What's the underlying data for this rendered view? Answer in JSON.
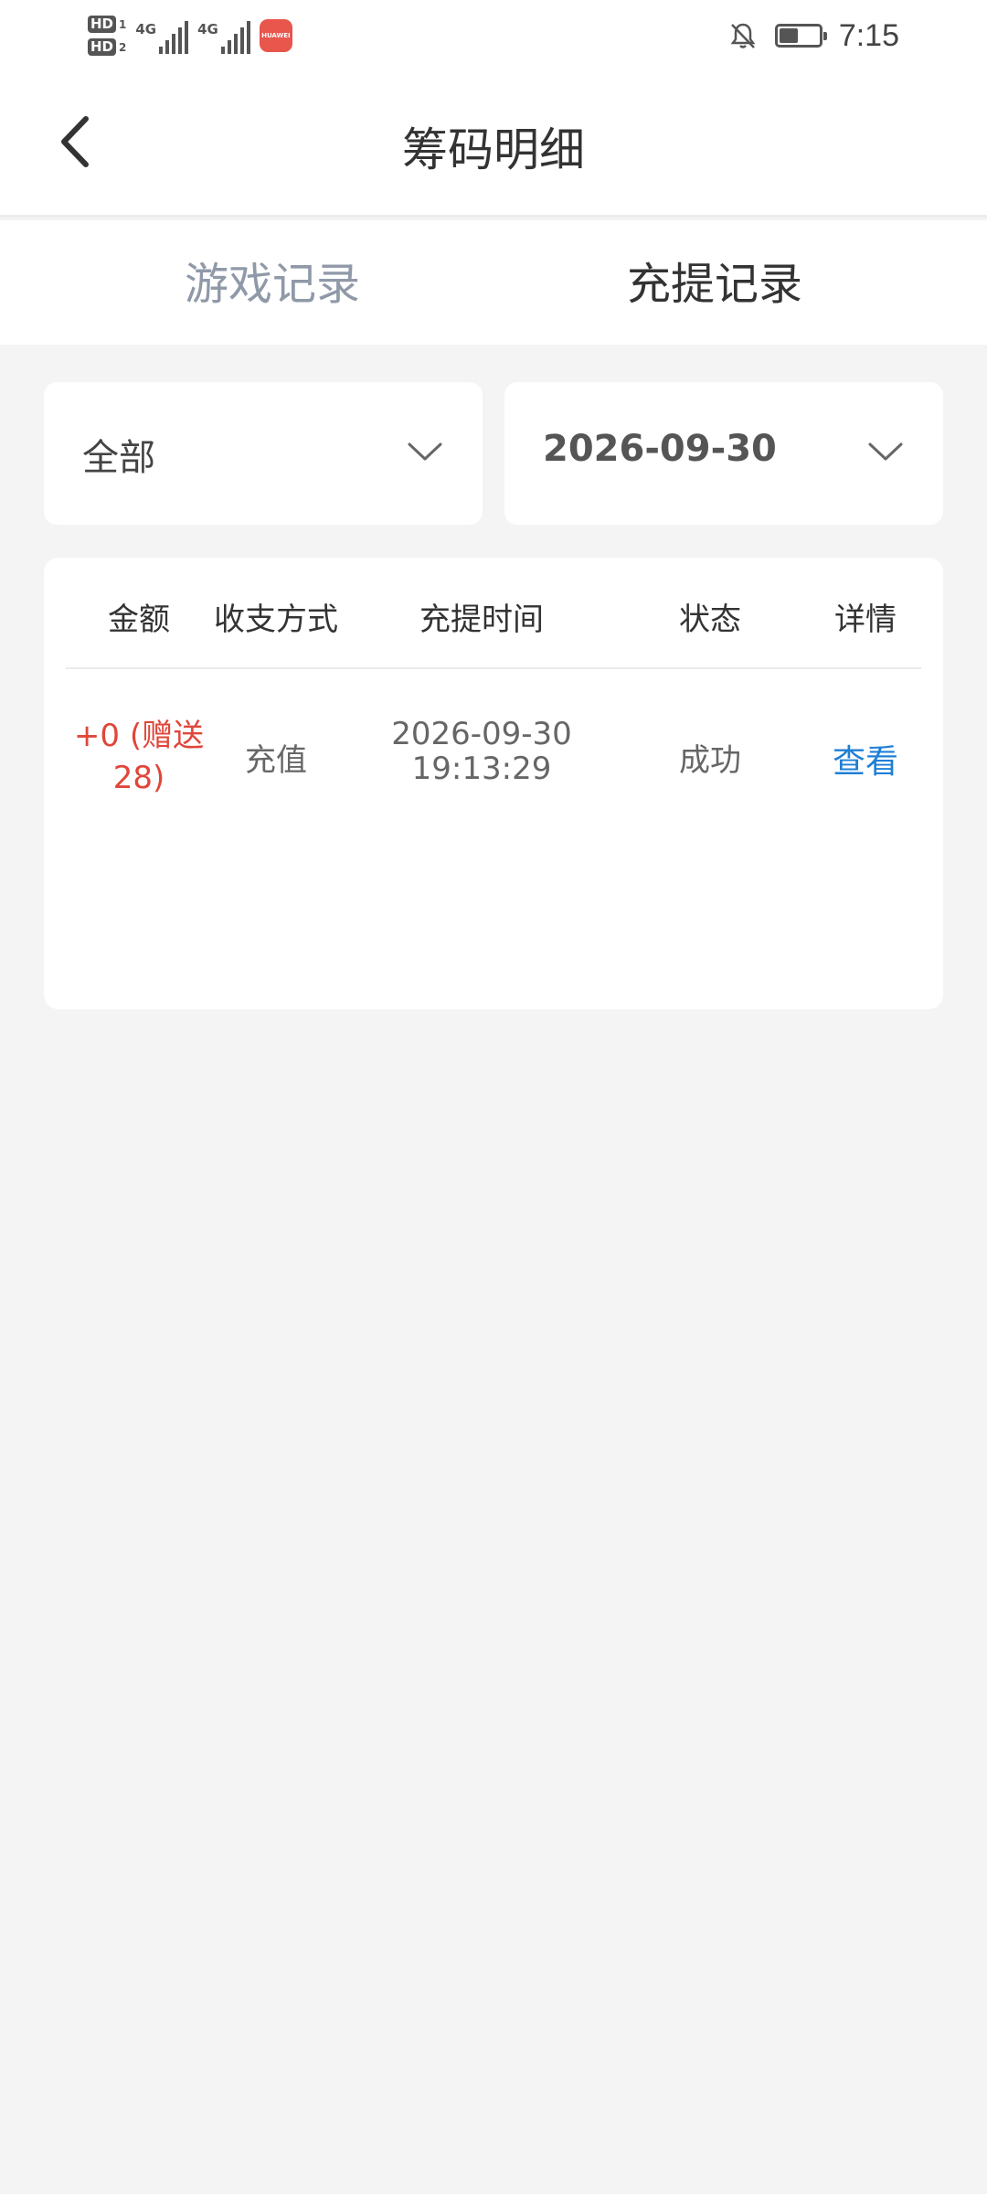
{
  "status_bar": {
    "sim1": "HD",
    "sim1_num": "1",
    "sim2": "HD",
    "sim2_num": "2",
    "net1": "4G",
    "net2": "4G",
    "app_badge": "HUAWEI",
    "time": "7:15",
    "icons": [
      "bell-off-icon",
      "battery-icon"
    ]
  },
  "nav": {
    "title": "筹码明细",
    "back_icon": "chevron-left-icon"
  },
  "tabs": [
    {
      "label": "游戏记录",
      "active": false
    },
    {
      "label": "充提记录",
      "active": true
    }
  ],
  "filters": {
    "type_selected": "全部",
    "date_selected": "2026-09-30",
    "dropdown_icon": "chevron-down-icon"
  },
  "table": {
    "headers": [
      "金额",
      "收支方式",
      "充提时间",
      "状态",
      "详情"
    ],
    "rows": [
      {
        "amount_line1": "+0 (赠送",
        "amount_line2": "28)",
        "method": "充值",
        "date": "2026-09-30",
        "time": "19:13:29",
        "status": "成功",
        "detail": "查看"
      }
    ]
  },
  "colors": {
    "amount": "#e0463a",
    "link": "#1e7fd6",
    "inactive_tab": "#8f99a8",
    "page_bg": "#f4f4f4"
  }
}
